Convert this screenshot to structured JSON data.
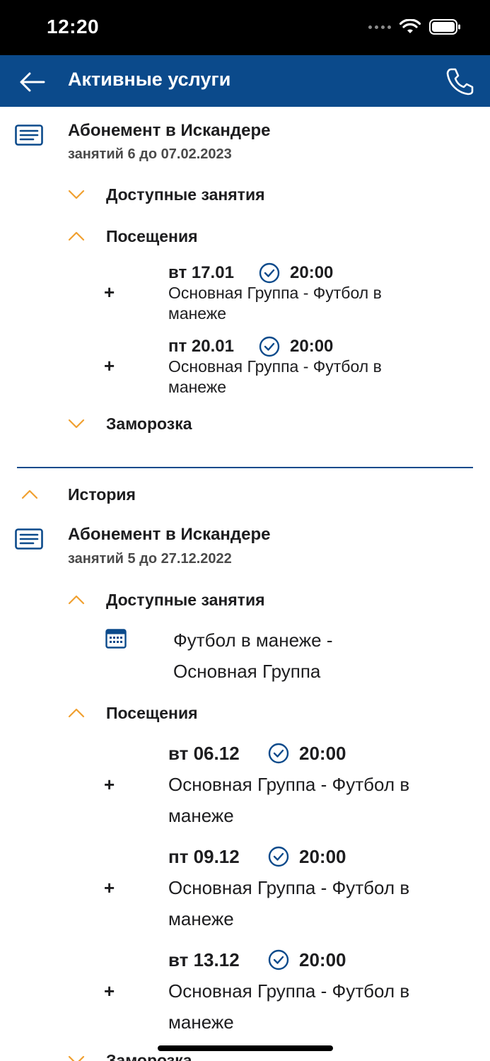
{
  "status_bar": {
    "time": "12:20"
  },
  "header": {
    "title": "Активные услуги"
  },
  "active": {
    "title": "Абонемент в Искандере",
    "subtitle": "занятий 6 до 07.02.2023",
    "available_label": "Доступные занятия",
    "visits_label": "Посещения",
    "visits": [
      {
        "date": "вт 17.01",
        "time": "20:00",
        "desc": "Основная Группа - Футбол в манеже"
      },
      {
        "date": "пт 20.01",
        "time": "20:00",
        "desc": "Основная Группа - Футбол в манеже"
      }
    ],
    "freeze_label": "Заморозка"
  },
  "history": {
    "label": "История",
    "title": "Абонемент в Искандере",
    "subtitle": "занятий 5 до 27.12.2022",
    "available_label": "Доступные занятия",
    "available_item": "Футбол в манеже - Основная Группа",
    "visits_label": "Посещения",
    "visits": [
      {
        "date": "вт 06.12",
        "time": "20:00",
        "desc": "Основная Группа - Футбол в манеже"
      },
      {
        "date": "пт 09.12",
        "time": "20:00",
        "desc": "Основная Группа - Футбол в манеже"
      },
      {
        "date": "вт 13.12",
        "time": "20:00",
        "desc": "Основная Группа - Футбол в манеже"
      }
    ],
    "freeze_label": "Заморозка"
  },
  "plus_symbol": "+",
  "colors": {
    "header_bg": "#0b4a8b",
    "accent_orange": "#f0a030",
    "check_blue": "#0b4a8b"
  }
}
